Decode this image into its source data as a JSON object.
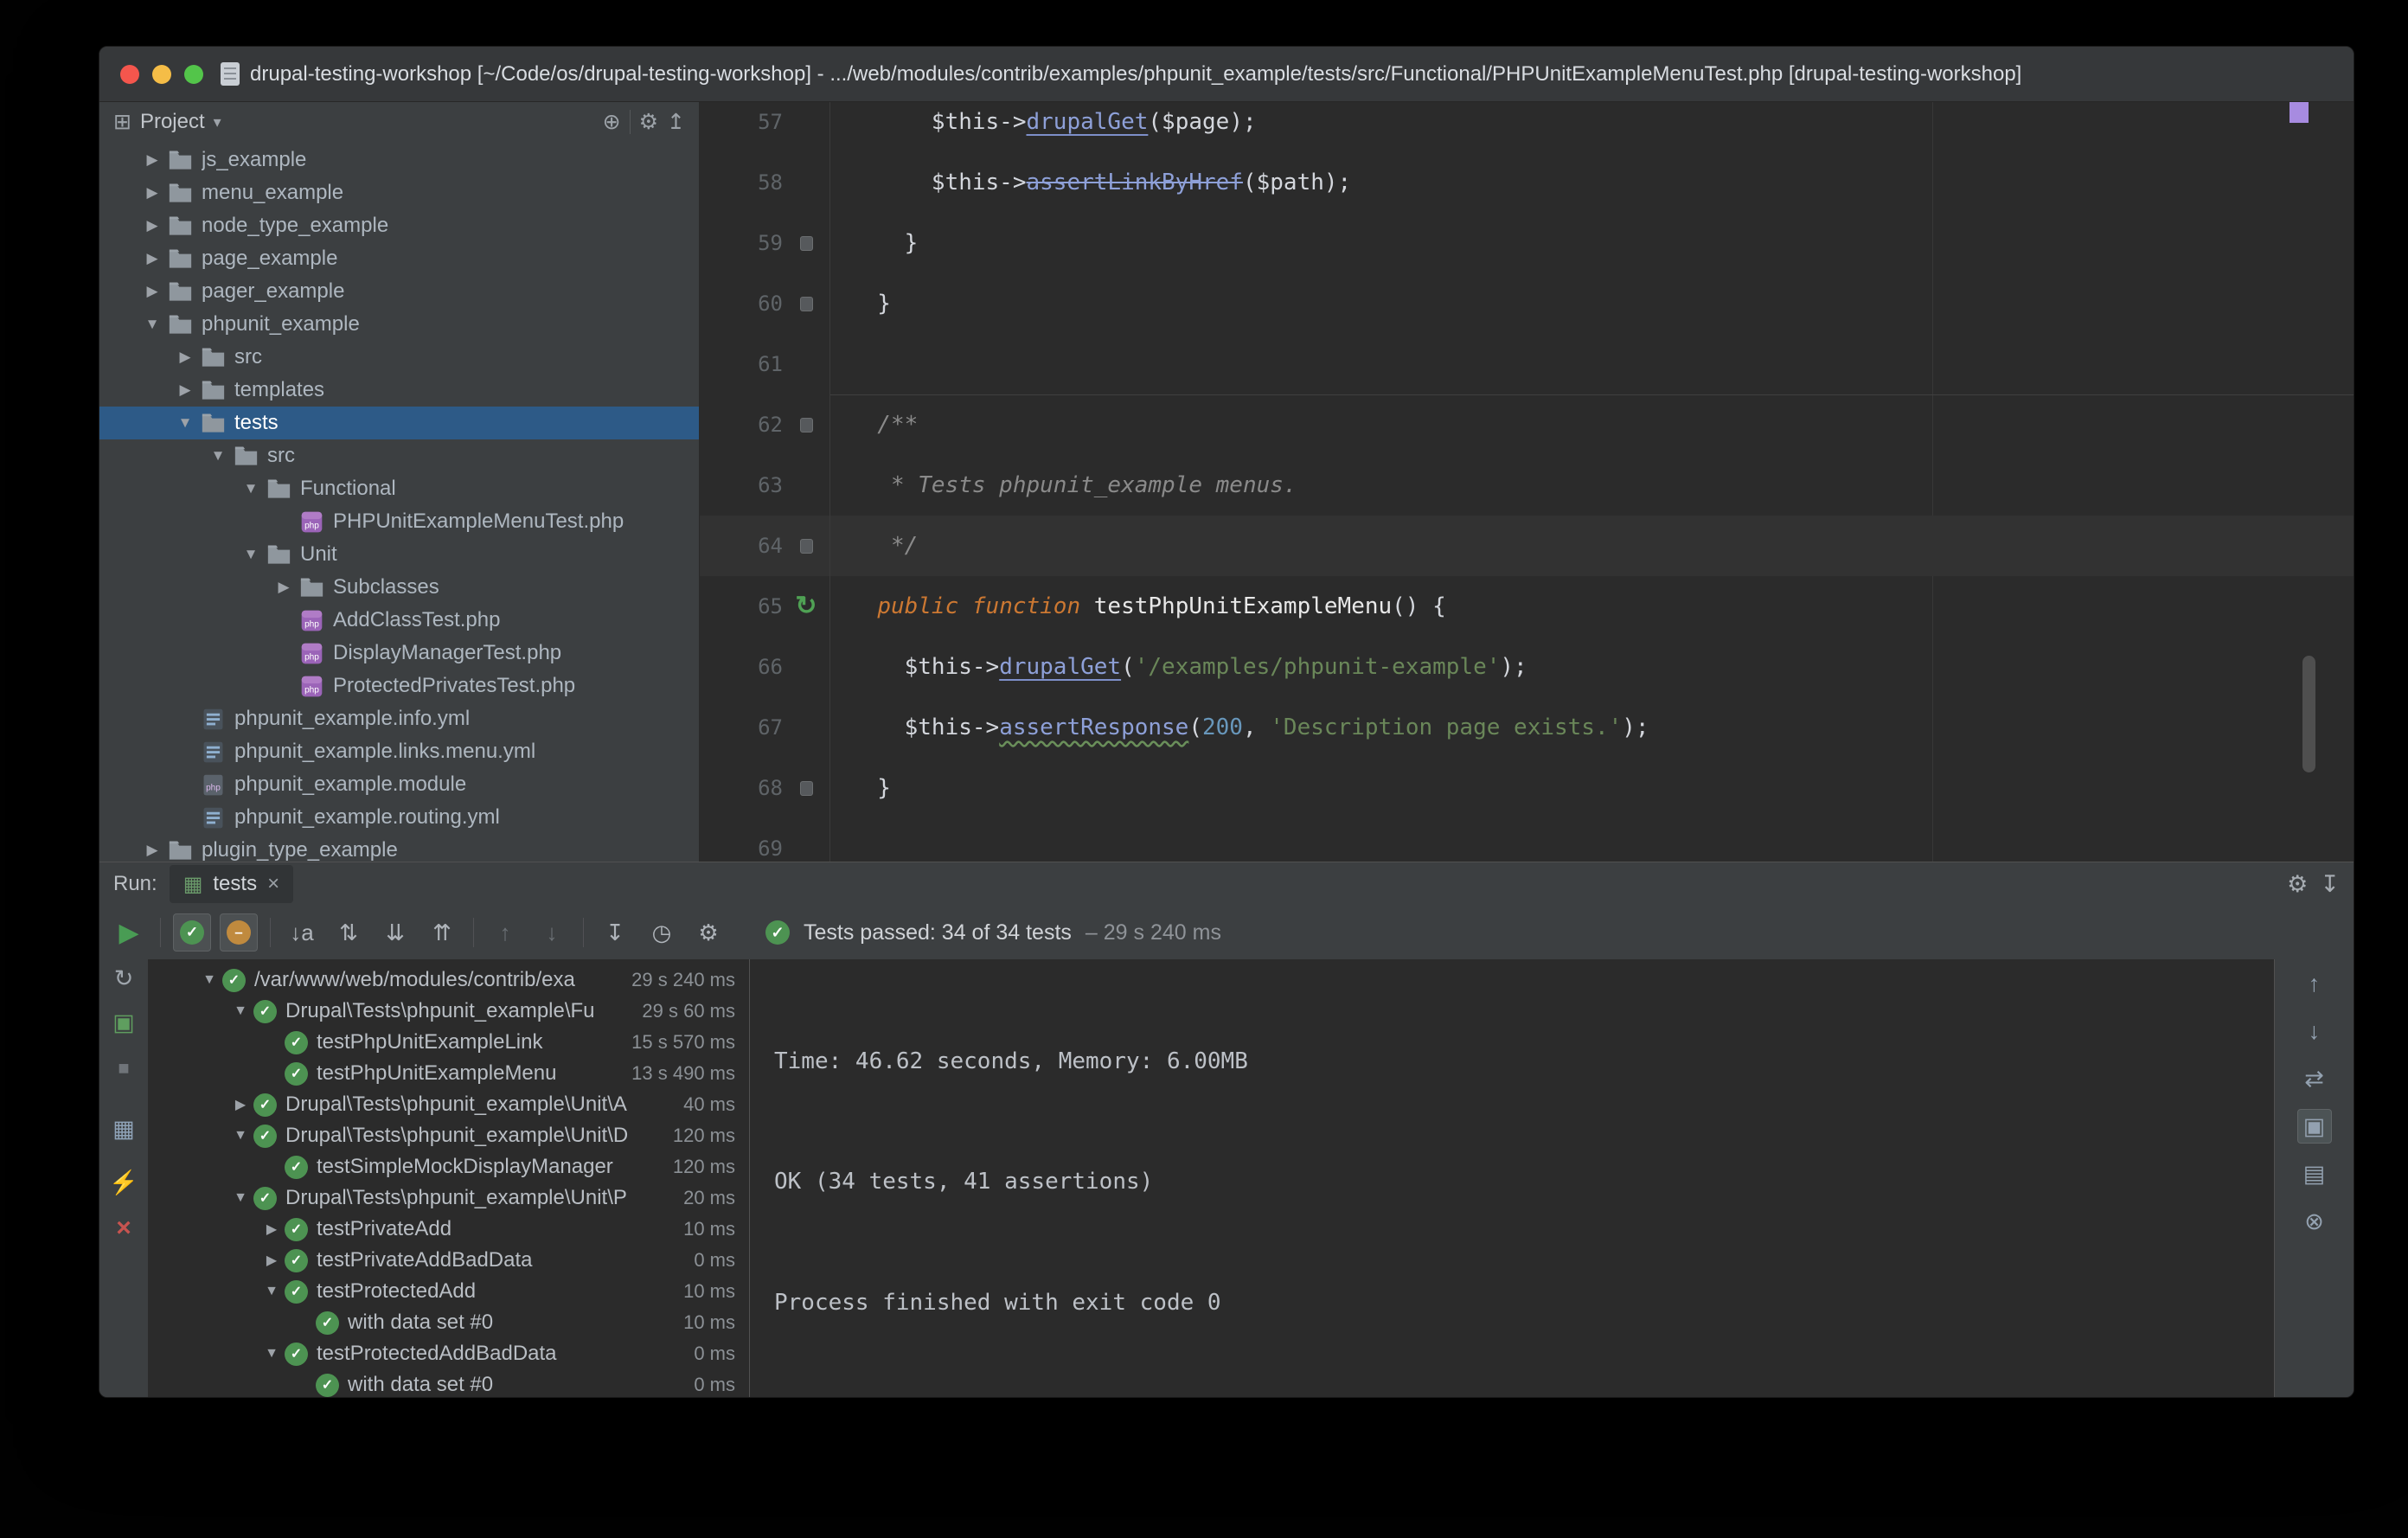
{
  "titlebar": {
    "title": "drupal-testing-workshop [~/Code/os/drupal-testing-workshop] - .../web/modules/contrib/examples/phpunit_example/tests/src/Functional/PHPUnitExampleMenuTest.php [drupal-testing-workshop]"
  },
  "icons": {
    "panel": "⊞",
    "caret_down": "▾",
    "crosshair": "⊕",
    "gear": "⚙",
    "collapse_panel": "↥",
    "arrow_down": "▼",
    "arrow_right": "▶",
    "play": "▶",
    "check": "✓",
    "dash": "–",
    "sort_alpha": "↓a",
    "sort_duration": "⇅",
    "expand_all": "⇊",
    "collapse_all": "⇈",
    "up": "↑",
    "down": "↓",
    "import": "↧",
    "history": "◷",
    "close": "×",
    "rerun": "↻",
    "autotest": "▣",
    "stop": "■",
    "monitor": "▦",
    "pin": "⚡",
    "swap": "⇄",
    "softwrap": "▣",
    "scroll_end": "▤",
    "clear": "⊗",
    "hide": "↧",
    "tab": "▦",
    "run_gutter": "↻"
  },
  "project_panel": {
    "title": "Project",
    "tree": [
      {
        "label": "js_example",
        "depth": 0,
        "icon": "folder",
        "arrow": "right"
      },
      {
        "label": "menu_example",
        "depth": 0,
        "icon": "folder",
        "arrow": "right"
      },
      {
        "label": "node_type_example",
        "depth": 0,
        "icon": "folder",
        "arrow": "right"
      },
      {
        "label": "page_example",
        "depth": 0,
        "icon": "folder",
        "arrow": "right"
      },
      {
        "label": "pager_example",
        "depth": 0,
        "icon": "folder",
        "arrow": "right"
      },
      {
        "label": "phpunit_example",
        "depth": 0,
        "icon": "folder",
        "arrow": "down"
      },
      {
        "label": "src",
        "depth": 1,
        "icon": "folder",
        "arrow": "right"
      },
      {
        "label": "templates",
        "depth": 1,
        "icon": "folder",
        "arrow": "right"
      },
      {
        "label": "tests",
        "depth": 1,
        "icon": "folder",
        "arrow": "down",
        "selected": true
      },
      {
        "label": "src",
        "depth": 2,
        "icon": "folder",
        "arrow": "down"
      },
      {
        "label": "Functional",
        "depth": 3,
        "icon": "folder",
        "arrow": "down"
      },
      {
        "label": "PHPUnitExampleMenuTest.php",
        "depth": 4,
        "icon": "php",
        "arrow": "none"
      },
      {
        "label": "Unit",
        "depth": 3,
        "icon": "folder",
        "arrow": "down"
      },
      {
        "label": "Subclasses",
        "depth": 4,
        "icon": "folder",
        "arrow": "right"
      },
      {
        "label": "AddClassTest.php",
        "depth": 4,
        "icon": "php",
        "arrow": "none"
      },
      {
        "label": "DisplayManagerTest.php",
        "depth": 4,
        "icon": "php",
        "arrow": "none"
      },
      {
        "label": "ProtectedPrivatesTest.php",
        "depth": 4,
        "icon": "php",
        "arrow": "none"
      },
      {
        "label": "phpunit_example.info.yml",
        "depth": 1,
        "icon": "yml",
        "arrow": "none"
      },
      {
        "label": "phpunit_example.links.menu.yml",
        "depth": 1,
        "icon": "yml",
        "arrow": "none"
      },
      {
        "label": "phpunit_example.module",
        "depth": 1,
        "icon": "module",
        "arrow": "none"
      },
      {
        "label": "phpunit_example.routing.yml",
        "depth": 1,
        "icon": "yml",
        "arrow": "none"
      },
      {
        "label": "plugin_type_example",
        "depth": 0,
        "icon": "folder",
        "arrow": "right"
      }
    ]
  },
  "editor": {
    "lines": [
      {
        "n": "57",
        "g": "",
        "t": [
          [
            "      $this->",
            "p"
          ],
          [
            "drupalGet",
            "m"
          ],
          [
            "(",
            "p"
          ],
          [
            "$page",
            "p"
          ],
          [
            ");",
            "p"
          ]
        ]
      },
      {
        "n": "58",
        "g": "",
        "t": [
          [
            "      $this->",
            "p"
          ],
          [
            "assertLinkByHref",
            "d"
          ],
          [
            "(",
            "p"
          ],
          [
            "$path",
            "p"
          ],
          [
            ");",
            "p"
          ]
        ]
      },
      {
        "n": "59",
        "g": "mark",
        "t": [
          [
            "    }",
            "p"
          ]
        ]
      },
      {
        "n": "60",
        "g": "mark",
        "t": [
          [
            "  }",
            "p"
          ]
        ]
      },
      {
        "n": "61",
        "g": "",
        "t": []
      },
      {
        "n": "62",
        "g": "mark",
        "sep": true,
        "t": [
          [
            "  /**",
            "c"
          ]
        ]
      },
      {
        "n": "63",
        "g": "",
        "t": [
          [
            "   * Tests phpunit_example menus.",
            "c"
          ]
        ]
      },
      {
        "n": "64",
        "g": "mark",
        "caret": true,
        "t": [
          [
            "   */",
            "c"
          ]
        ]
      },
      {
        "n": "65",
        "g": "run",
        "t": [
          [
            "  ",
            "p"
          ],
          [
            "public function",
            "k"
          ],
          [
            " ",
            "p"
          ],
          [
            "testPhpUnitExampleMenu",
            "f"
          ],
          [
            "() {",
            "p"
          ]
        ]
      },
      {
        "n": "66",
        "g": "",
        "t": [
          [
            "    $this->",
            "p"
          ],
          [
            "drupalGet",
            "m"
          ],
          [
            "(",
            "p"
          ],
          [
            "'/examples/phpunit-example'",
            "s"
          ],
          [
            ");",
            "p"
          ]
        ]
      },
      {
        "n": "67",
        "g": "",
        "t": [
          [
            "    $this->",
            "p"
          ],
          [
            "assertResponse",
            "w"
          ],
          [
            "(",
            "p"
          ],
          [
            "200",
            "n"
          ],
          [
            ", ",
            "p"
          ],
          [
            "'Description page exists.'",
            "s"
          ],
          [
            ");",
            "p"
          ]
        ]
      },
      {
        "n": "68",
        "g": "mark",
        "t": [
          [
            "  }",
            "p"
          ]
        ]
      },
      {
        "n": "69",
        "g": "",
        "t": []
      }
    ]
  },
  "run_panel": {
    "label": "Run:",
    "tab": "tests",
    "status": {
      "text": "Tests passed: 34 of 34 tests",
      "duration": "– 29 s 240 ms"
    },
    "tests": [
      {
        "label": "/var/www/web/modules/contrib/exa",
        "duration": "29 s 240 ms",
        "indent": 0,
        "arrow": "down"
      },
      {
        "label": "Drupal\\Tests\\phpunit_example\\Fu",
        "duration": "29 s 60 ms",
        "indent": 1,
        "arrow": "down"
      },
      {
        "label": "testPhpUnitExampleLink",
        "duration": "15 s 570 ms",
        "indent": 2,
        "arrow": "none"
      },
      {
        "label": "testPhpUnitExampleMenu",
        "duration": "13 s 490 ms",
        "indent": 2,
        "arrow": "none"
      },
      {
        "label": "Drupal\\Tests\\phpunit_example\\Unit\\A",
        "duration": "40 ms",
        "indent": 1,
        "arrow": "right"
      },
      {
        "label": "Drupal\\Tests\\phpunit_example\\Unit\\D",
        "duration": "120 ms",
        "indent": 1,
        "arrow": "down"
      },
      {
        "label": "testSimpleMockDisplayManager",
        "duration": "120 ms",
        "indent": 2,
        "arrow": "none"
      },
      {
        "label": "Drupal\\Tests\\phpunit_example\\Unit\\P",
        "duration": "20 ms",
        "indent": 1,
        "arrow": "down"
      },
      {
        "label": "testPrivateAdd",
        "duration": "10 ms",
        "indent": 2,
        "arrow": "right"
      },
      {
        "label": "testPrivateAddBadData",
        "duration": "0 ms",
        "indent": 2,
        "arrow": "right"
      },
      {
        "label": "testProtectedAdd",
        "duration": "10 ms",
        "indent": 2,
        "arrow": "down"
      },
      {
        "label": "with data set #0",
        "duration": "10 ms",
        "indent": 3,
        "arrow": "none"
      },
      {
        "label": "testProtectedAddBadData",
        "duration": "0 ms",
        "indent": 2,
        "arrow": "down"
      },
      {
        "label": "with data set #0",
        "duration": "0 ms",
        "indent": 3,
        "arrow": "none"
      }
    ],
    "console": {
      "lines": [
        "Time: 46.62 seconds, Memory: 6.00MB",
        "OK (34 tests, 41 assertions)",
        "Process finished with exit code 0"
      ]
    }
  }
}
